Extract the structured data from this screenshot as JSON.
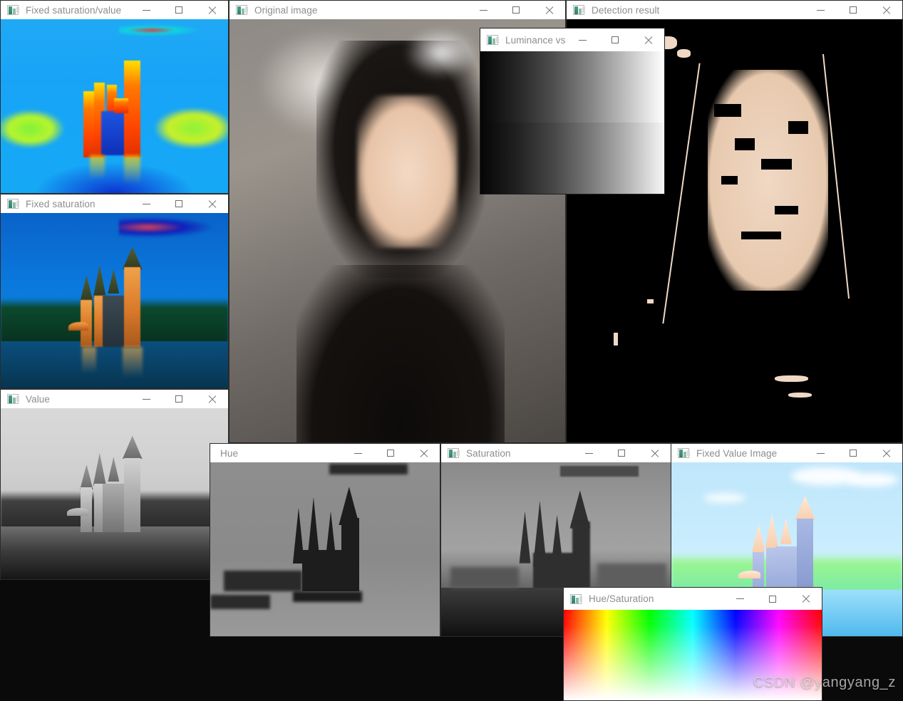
{
  "desktop": {
    "background": "#0a0a0a",
    "watermark": "CSDN @yangyang_z"
  },
  "windows": [
    {
      "id": "fixed-saturation-value",
      "title": "Fixed saturation/value",
      "icon": "opencv-image-icon",
      "content": "false-color (jet colormap) castle image",
      "buttons": {
        "minimize": "—",
        "maximize": "❐",
        "close": "✕"
      }
    },
    {
      "id": "fixed-saturation",
      "title": "Fixed saturation",
      "icon": "opencv-image-icon",
      "content": "saturation-boosted castle photograph",
      "buttons": {
        "minimize": "—",
        "maximize": "❐",
        "close": "✕"
      }
    },
    {
      "id": "value",
      "title": "Value",
      "icon": "opencv-image-icon",
      "content": "grayscale value channel of castle photograph",
      "buttons": {
        "minimize": "—",
        "maximize": "❐",
        "close": "✕"
      }
    },
    {
      "id": "original-image",
      "title": "Original image",
      "icon": "opencv-image-icon",
      "content": "portrait photograph of a woman",
      "buttons": {
        "minimize": "—",
        "maximize": "❐",
        "close": "✕"
      }
    },
    {
      "id": "detection-result",
      "title": "Detection result",
      "icon": "opencv-image-icon",
      "content": "binary skin detection mask on black background",
      "buttons": {
        "minimize": "—",
        "maximize": "❐",
        "close": "✕"
      }
    },
    {
      "id": "luminance",
      "title": "Luminance vs ...",
      "icon": "opencv-image-icon",
      "content": "horizontal black-to-white luminance gradient, two bands",
      "buttons": {
        "minimize": "—",
        "maximize": "❐",
        "close": "✕"
      }
    },
    {
      "id": "hue",
      "title": "Hue",
      "icon": "opencv-image-icon",
      "content": "hue channel grayscale image of castle",
      "buttons": {
        "minimize": "—",
        "maximize": "❐",
        "close": "✕"
      }
    },
    {
      "id": "saturation",
      "title": "Saturation",
      "icon": "opencv-image-icon",
      "content": "saturation channel grayscale image of castle",
      "buttons": {
        "minimize": "—",
        "maximize": "❐",
        "close": "✕"
      }
    },
    {
      "id": "fixed-value-image",
      "title": "Fixed Value Image",
      "icon": "opencv-image-icon",
      "content": "pastel high-value castle image",
      "buttons": {
        "minimize": "—",
        "maximize": "❐",
        "close": "✕"
      }
    },
    {
      "id": "hue-saturation",
      "title": "Hue/Saturation",
      "icon": "opencv-image-icon",
      "content": "hue horizontal, saturation vertical color chart",
      "buttons": {
        "minimize": "—",
        "maximize": "❐",
        "close": "✕"
      }
    }
  ]
}
